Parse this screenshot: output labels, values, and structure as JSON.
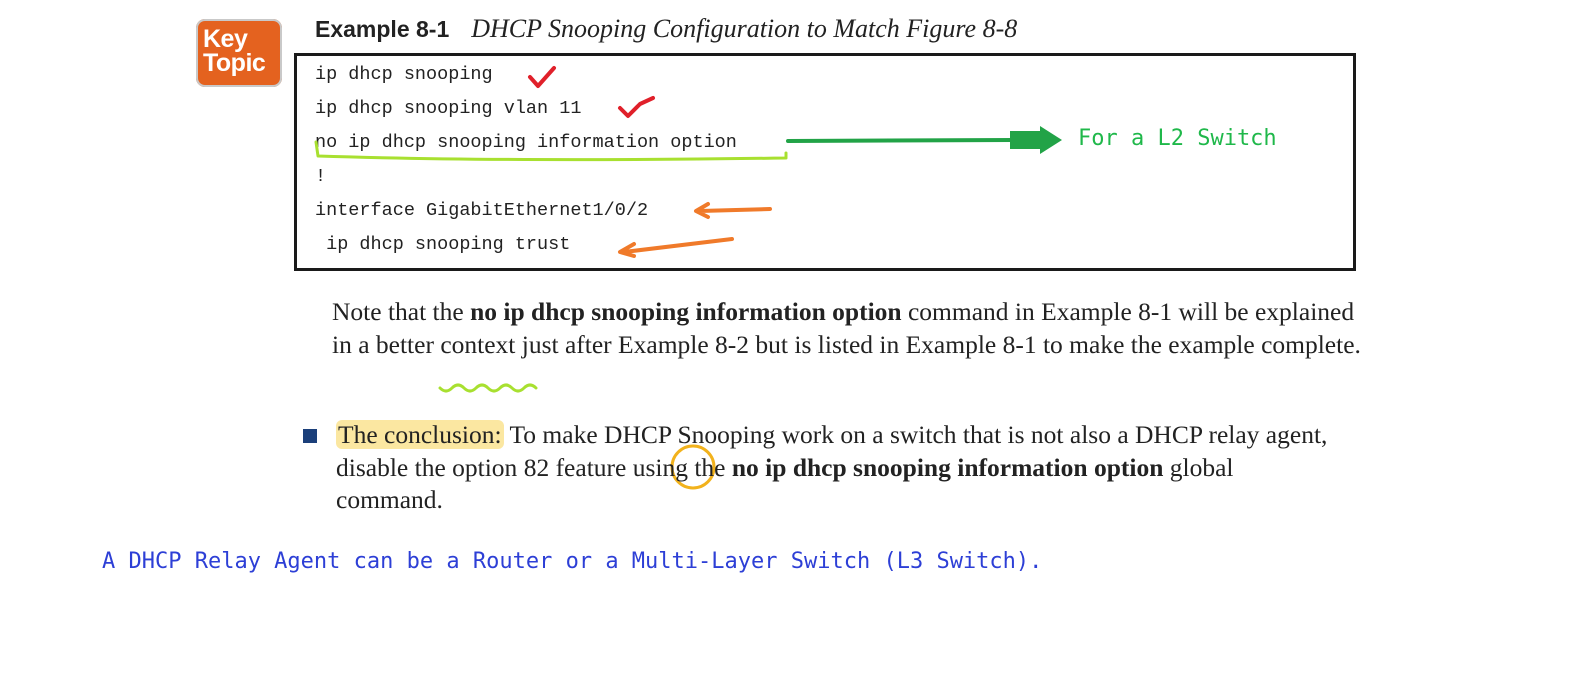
{
  "badge": {
    "line1": "Key",
    "line2": "Topic"
  },
  "example": {
    "label": "Example 8-1",
    "caption": "DHCP Snooping Configuration to Match Figure 8-8"
  },
  "code": {
    "lines": [
      "ip dhcp snooping",
      "ip dhcp snooping vlan 11",
      "no ip dhcp snooping information option",
      "!",
      "interface GigabitEthernet1/0/2",
      " ip dhcp snooping trust"
    ]
  },
  "annotations": {
    "l2_switch": "For a L2 Switch",
    "colors": {
      "checkmark": "#e0202a",
      "green_arrow": "#22a347",
      "underline": "#a8e030",
      "orange_arrow": "#f07a2a",
      "circle": "#f2b21c"
    }
  },
  "note": {
    "p1": "Note that the ",
    "b1": "no ip dhcp snooping information option",
    "p2": " command in Example 8-1 will be explained in a better context just after Example 8-2 but is listed in Example 8-1 to make the example ",
    "p3": "complete",
    "p4": "."
  },
  "bullet": {
    "highlight": "The conclusion:",
    "t1": " To make DHCP Snooping work on a switch that is not also a DHCP relay agent, disable the option ",
    "circled": "82",
    "t2": " feature using the ",
    "b1": "no ip dhcp snooping information option",
    "t3": " global command."
  },
  "footer": {
    "text": "A DHCP Relay Agent can be a Router or a Multi-Layer Switch (L3 Switch)."
  }
}
